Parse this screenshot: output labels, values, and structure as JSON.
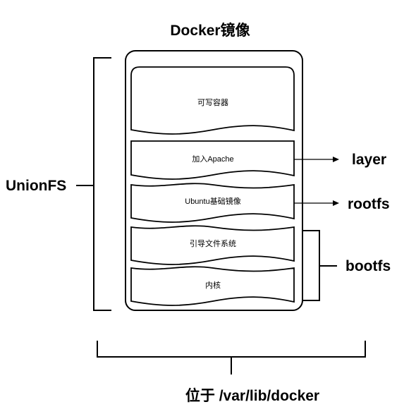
{
  "title": "Docker镜像",
  "layers": [
    {
      "label": "可写容器"
    },
    {
      "label": "加入Apache"
    },
    {
      "label": "Ubuntu基础镜像"
    },
    {
      "label": "引导文件系统"
    },
    {
      "label": "内核"
    }
  ],
  "annotations": {
    "unionfs": "UnionFS",
    "layer": "layer",
    "rootfs": "rootfs",
    "bootfs": "bootfs",
    "location": "位于 /var/lib/docker"
  },
  "colors": {
    "stroke": "#000000",
    "background": "#ffffff"
  }
}
